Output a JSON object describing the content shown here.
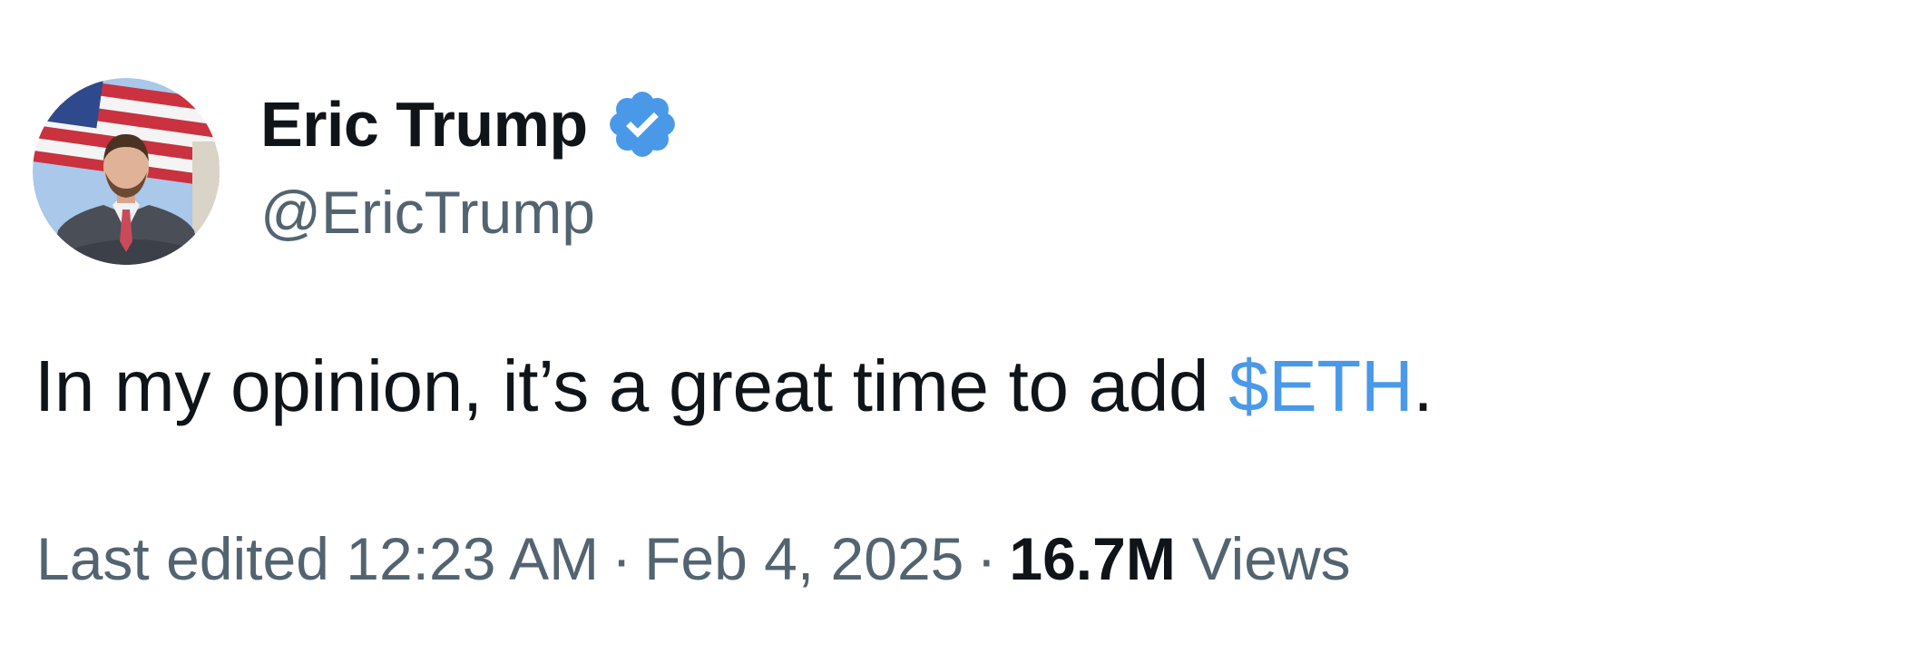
{
  "author": {
    "display_name": "Eric Trump",
    "handle": "@EricTrump",
    "verified": true,
    "verified_badge_color": "#4a99e9",
    "avatar_icon": "profile-photo"
  },
  "tweet": {
    "text_before": "In my opinion, it’s a great time to add ",
    "cashtag": "$ETH",
    "text_after": ".",
    "cashtag_color": "#4a99e9"
  },
  "meta": {
    "edited_label": "Last edited 12:23 AM",
    "separator": "·",
    "date": "Feb 4, 2025",
    "views_count": "16.7M",
    "views_label": "Views"
  }
}
